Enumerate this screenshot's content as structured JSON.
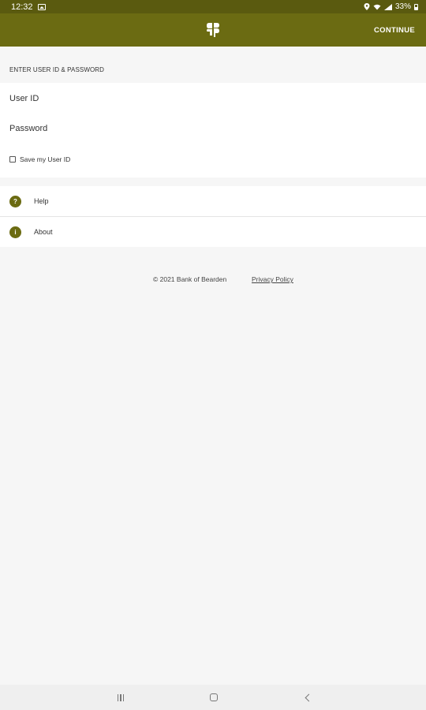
{
  "status_bar": {
    "time": "12:32",
    "battery": "33%"
  },
  "app_bar": {
    "logo_icon": "bank-logo-icon",
    "continue_label": "CONTINUE"
  },
  "login": {
    "section_header": "ENTER USER ID & PASSWORD",
    "user_id_placeholder": "User ID",
    "password_placeholder": "Password",
    "save_user_id_label": "Save my User ID",
    "save_user_id_checked": false
  },
  "links": [
    {
      "label": "Help",
      "icon": "help-icon",
      "glyph": "?"
    },
    {
      "label": "About",
      "icon": "info-icon",
      "glyph": "i"
    }
  ],
  "footer": {
    "copyright": "© 2021 Bank of Bearden",
    "privacy_link": "Privacy Policy"
  },
  "colors": {
    "status_bar": "#5a5a0f",
    "app_bar": "#6b6b12",
    "accent": "#6b6b12",
    "background": "#f6f6f6"
  }
}
